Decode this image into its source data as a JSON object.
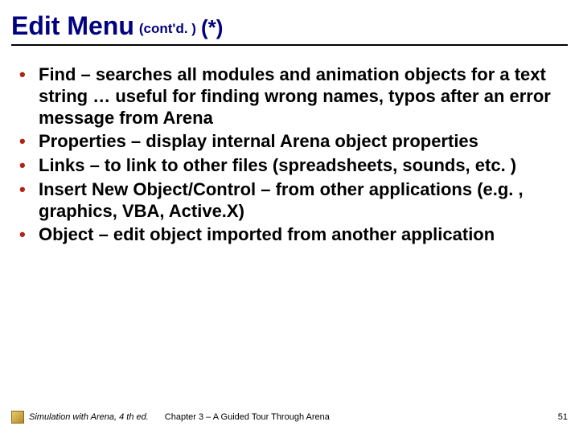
{
  "title": {
    "main": "Edit Menu",
    "sub": "(cont'd. )",
    "tail": "(*)"
  },
  "bullets": [
    "Find – searches all modules and animation objects for a text string … useful for finding wrong names, typos after an error message from Arena",
    "Properties – display internal Arena object properties",
    "Links – to link to other files (spreadsheets, sounds, etc. )",
    "Insert New Object/Control – from other applications (e.g. , graphics, VBA, Active.X)",
    "Object – edit object imported from another application"
  ],
  "footer": {
    "left": "Simulation with Arena, 4 th ed.",
    "center": "Chapter 3 – A Guided Tour Through Arena",
    "page": "51"
  }
}
